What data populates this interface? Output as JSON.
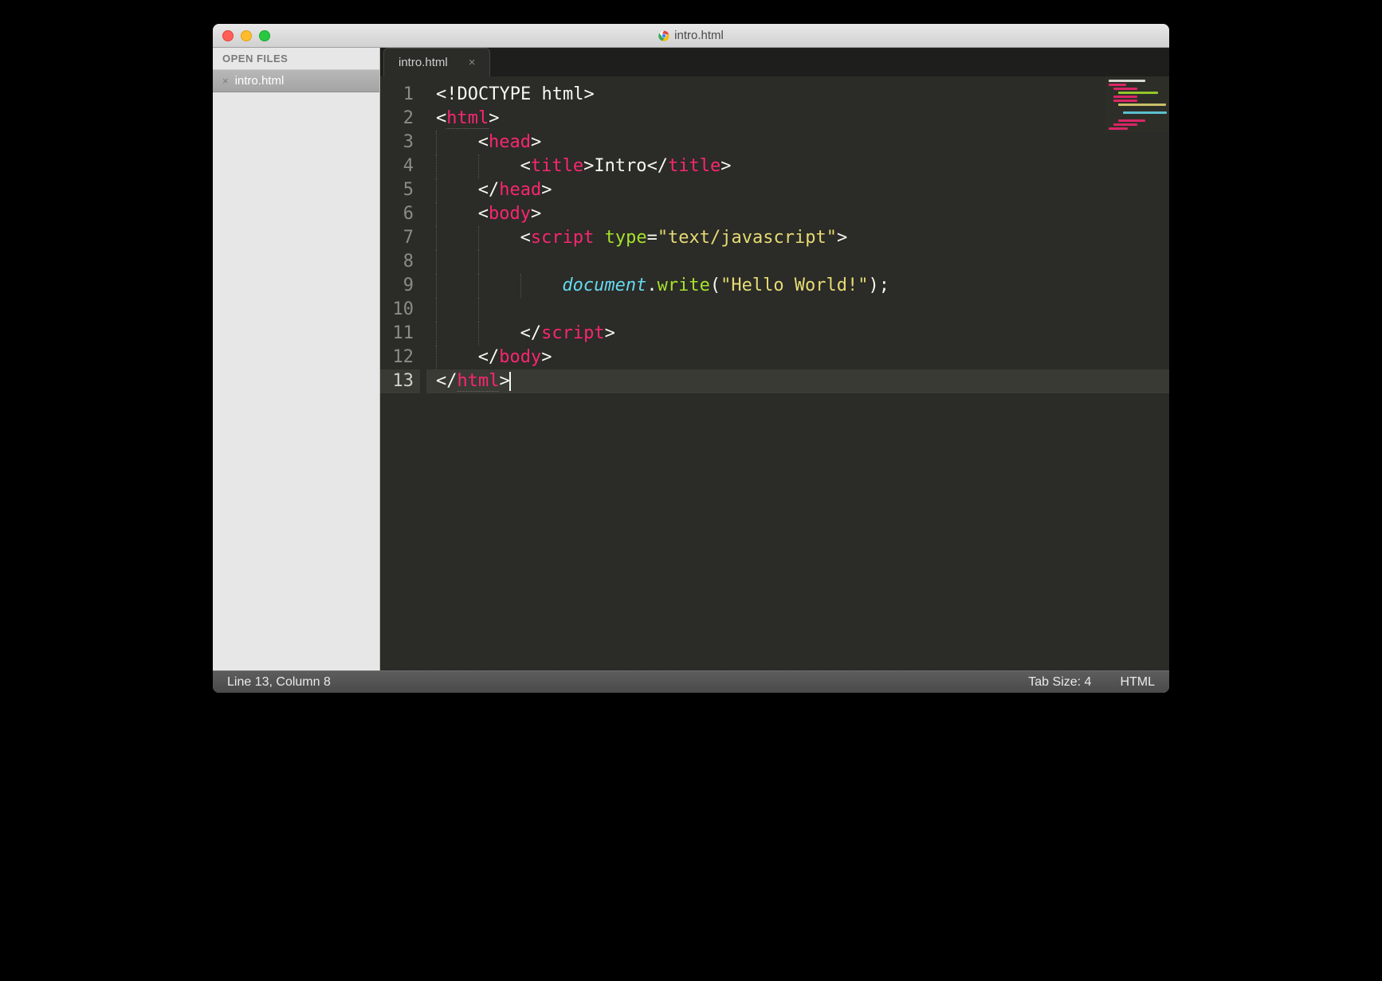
{
  "titlebar": {
    "title": "intro.html"
  },
  "sidebar": {
    "header": "OPEN FILES",
    "items": [
      {
        "label": "intro.html"
      }
    ]
  },
  "tabs": [
    {
      "label": "intro.html",
      "close": "×"
    }
  ],
  "code": {
    "lines": [
      {
        "n": "1",
        "indent": 0,
        "tokens": [
          {
            "t": "<!",
            "c": "punct"
          },
          {
            "t": "DOCTYPE html",
            "c": "doctype"
          },
          {
            "t": ">",
            "c": "punct"
          }
        ]
      },
      {
        "n": "2",
        "indent": 0,
        "tokens": [
          {
            "t": "<",
            "c": "punct"
          },
          {
            "t": "html",
            "c": "tag",
            "u": true
          },
          {
            "t": ">",
            "c": "punct"
          }
        ]
      },
      {
        "n": "3",
        "indent": 1,
        "tokens": [
          {
            "t": "<",
            "c": "punct"
          },
          {
            "t": "head",
            "c": "tag"
          },
          {
            "t": ">",
            "c": "punct"
          }
        ]
      },
      {
        "n": "4",
        "indent": 2,
        "tokens": [
          {
            "t": "<",
            "c": "punct"
          },
          {
            "t": "title",
            "c": "tag"
          },
          {
            "t": ">",
            "c": "punct"
          },
          {
            "t": "Intro",
            "c": "plain"
          },
          {
            "t": "</",
            "c": "punct"
          },
          {
            "t": "title",
            "c": "tag"
          },
          {
            "t": ">",
            "c": "punct"
          }
        ]
      },
      {
        "n": "5",
        "indent": 1,
        "tokens": [
          {
            "t": "</",
            "c": "punct"
          },
          {
            "t": "head",
            "c": "tag"
          },
          {
            "t": ">",
            "c": "punct"
          }
        ]
      },
      {
        "n": "6",
        "indent": 1,
        "tokens": [
          {
            "t": "<",
            "c": "punct"
          },
          {
            "t": "body",
            "c": "tag"
          },
          {
            "t": ">",
            "c": "punct"
          }
        ]
      },
      {
        "n": "7",
        "indent": 2,
        "tokens": [
          {
            "t": "<",
            "c": "punct"
          },
          {
            "t": "script",
            "c": "tag"
          },
          {
            "t": " ",
            "c": "plain"
          },
          {
            "t": "type",
            "c": "attr"
          },
          {
            "t": "=",
            "c": "punct"
          },
          {
            "t": "\"text/javascript\"",
            "c": "str"
          },
          {
            "t": ">",
            "c": "punct"
          }
        ]
      },
      {
        "n": "8",
        "indent": 2,
        "tokens": []
      },
      {
        "n": "9",
        "indent": 3,
        "tokens": [
          {
            "t": "document",
            "c": "var"
          },
          {
            "t": ".",
            "c": "punct"
          },
          {
            "t": "write",
            "c": "func"
          },
          {
            "t": "(",
            "c": "punct"
          },
          {
            "t": "\"Hello World!\"",
            "c": "str"
          },
          {
            "t": ");",
            "c": "punct"
          }
        ]
      },
      {
        "n": "10",
        "indent": 2,
        "tokens": []
      },
      {
        "n": "11",
        "indent": 2,
        "tokens": [
          {
            "t": "</",
            "c": "punct"
          },
          {
            "t": "script",
            "c": "tag"
          },
          {
            "t": ">",
            "c": "punct"
          }
        ]
      },
      {
        "n": "12",
        "indent": 1,
        "tokens": [
          {
            "t": "</",
            "c": "punct"
          },
          {
            "t": "body",
            "c": "tag"
          },
          {
            "t": ">",
            "c": "punct"
          }
        ]
      },
      {
        "n": "13",
        "indent": 0,
        "current": true,
        "cursor": true,
        "tokens": [
          {
            "t": "</",
            "c": "punct"
          },
          {
            "t": "html",
            "c": "tag",
            "u": true
          },
          {
            "t": ">",
            "c": "punct"
          }
        ]
      }
    ]
  },
  "statusbar": {
    "position": "Line 13, Column 8",
    "tabsize": "Tab Size: 4",
    "syntax": "HTML"
  },
  "indent_width_chars": 4
}
